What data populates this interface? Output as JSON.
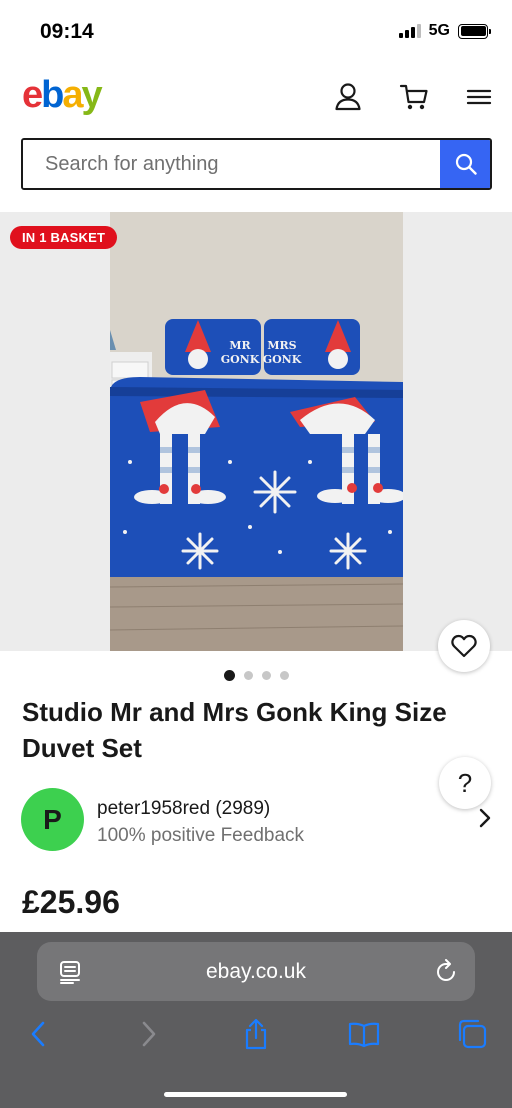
{
  "status_bar": {
    "time": "09:14",
    "network": "5G"
  },
  "header": {
    "logo": {
      "e": "e",
      "b": "b",
      "a": "a",
      "y": "y"
    },
    "icons": [
      "account-icon",
      "cart-icon",
      "menu-icon"
    ]
  },
  "search": {
    "placeholder": "Search for anything",
    "button_icon": "search-icon",
    "accent": "#3665f3"
  },
  "listing": {
    "badge": "IN 1 BASKET",
    "image_count": 4,
    "active_image": 1,
    "pillow_left": [
      "MR",
      "GONK"
    ],
    "pillow_right": [
      "MRS",
      "GONK"
    ],
    "title": "Studio Mr and Mrs Gonk King Size Duvet Set",
    "seller": {
      "initial": "P",
      "name": "peter1958red (2989)",
      "feedback": "100% positive Feedback",
      "avatar_color": "#3dd04f"
    },
    "price": "£25.96"
  },
  "browser": {
    "url": "ebay.co.uk",
    "icons": [
      "reader-icon",
      "reload-icon",
      "back-icon",
      "forward-icon",
      "share-icon",
      "bookmarks-icon",
      "tabs-icon"
    ]
  },
  "colors": {
    "badge": "#e0101d",
    "ios_blue": "#1a7cff"
  }
}
